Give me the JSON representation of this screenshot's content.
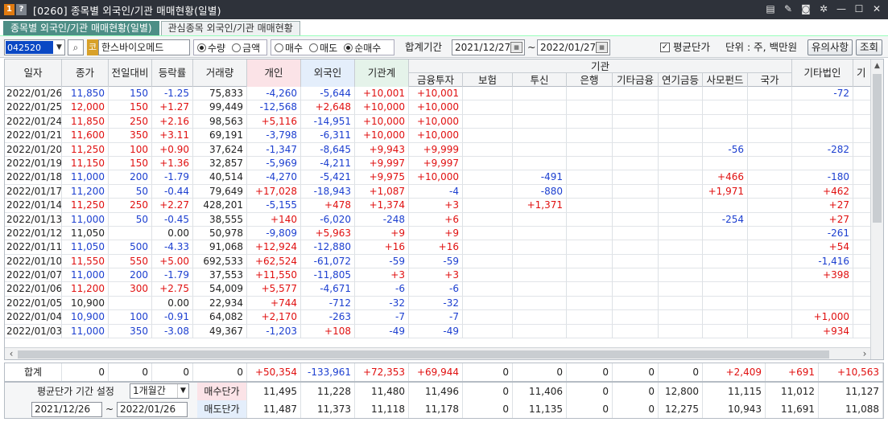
{
  "window": {
    "num_badge": "1",
    "help_badge": "?",
    "title": "[0260] 종목별 외국인/기관 매매현황(일별)",
    "icons": [
      "layout-icon",
      "memo-icon",
      "camera-icon",
      "settings-icon",
      "minimize-icon",
      "maximize-icon",
      "close-icon"
    ]
  },
  "tabs": [
    {
      "label": "종목별 외국인/기관 매매현황(일별)",
      "active": true
    },
    {
      "label": "관심종목 외국인/기관 매매현황",
      "active": false
    }
  ],
  "toolbar": {
    "code": "042520",
    "market_badge": "코",
    "stock_name": "한스바이오메드",
    "unit_options": [
      "수량",
      "금액"
    ],
    "unit_selected": "수량",
    "trade_options": [
      "매수",
      "매도",
      "순매수"
    ],
    "trade_selected": "순매수",
    "period_label": "합계기간",
    "date_from": "2021/12/27",
    "tilde": "~",
    "date_to": "2022/01/27",
    "avg_price_label": "평균단가",
    "avg_price_checked": true,
    "unit_text": "단위 : 주, 백만원",
    "notice_button": "유의사항",
    "query_button": "조회"
  },
  "headers": {
    "date": "일자",
    "close": "종가",
    "change": "전일대비",
    "rate": "등락률",
    "volume": "거래량",
    "individual": "개인",
    "foreign": "외국인",
    "inst_total": "기관계",
    "inst_group": "기관",
    "financial_invest": "금융투자",
    "insurance": "보험",
    "trust": "투신",
    "bank": "은행",
    "other_finance": "기타금융",
    "pension": "연기금등",
    "private_fund": "사모펀드",
    "nation": "국가",
    "other_corp": "기타법인",
    "cut_col": "기"
  },
  "rows": [
    {
      "date": "2022/01/26",
      "close": "11,850",
      "close_c": "blu",
      "change": "150",
      "change_c": "blu",
      "rate": "-1.25",
      "rate_c": "blu",
      "volume": "75,833",
      "ind": "-4,260",
      "frg": "-5,644",
      "inst": "+10,001",
      "fin": "+10,001",
      "ins": "",
      "trs": "",
      "bnk": "",
      "oth": "",
      "pen": "",
      "pef": "",
      "nat": "",
      "corp": "-72"
    },
    {
      "date": "2022/01/25",
      "close": "12,000",
      "close_c": "red",
      "change": "150",
      "change_c": "red",
      "rate": "+1.27",
      "rate_c": "red",
      "volume": "99,449",
      "ind": "-12,568",
      "frg": "+2,648",
      "inst": "+10,000",
      "fin": "+10,000",
      "ins": "",
      "trs": "",
      "bnk": "",
      "oth": "",
      "pen": "",
      "pef": "",
      "nat": "",
      "corp": ""
    },
    {
      "date": "2022/01/24",
      "close": "11,850",
      "close_c": "red",
      "change": "250",
      "change_c": "red",
      "rate": "+2.16",
      "rate_c": "red",
      "volume": "98,563",
      "ind": "+5,116",
      "frg": "-14,951",
      "inst": "+10,000",
      "fin": "+10,000",
      "ins": "",
      "trs": "",
      "bnk": "",
      "oth": "",
      "pen": "",
      "pef": "",
      "nat": "",
      "corp": ""
    },
    {
      "date": "2022/01/21",
      "close": "11,600",
      "close_c": "red",
      "change": "350",
      "change_c": "red",
      "rate": "+3.11",
      "rate_c": "red",
      "volume": "69,191",
      "ind": "-3,798",
      "frg": "-6,311",
      "inst": "+10,000",
      "fin": "+10,000",
      "ins": "",
      "trs": "",
      "bnk": "",
      "oth": "",
      "pen": "",
      "pef": "",
      "nat": "",
      "corp": ""
    },
    {
      "date": "2022/01/20",
      "close": "11,250",
      "close_c": "red",
      "change": "100",
      "change_c": "red",
      "rate": "+0.90",
      "rate_c": "red",
      "volume": "37,624",
      "ind": "-1,347",
      "frg": "-8,645",
      "inst": "+9,943",
      "fin": "+9,999",
      "ins": "",
      "trs": "",
      "bnk": "",
      "oth": "",
      "pen": "",
      "pef": "-56",
      "nat": "",
      "corp": "-282"
    },
    {
      "date": "2022/01/19",
      "close": "11,150",
      "close_c": "red",
      "change": "150",
      "change_c": "red",
      "rate": "+1.36",
      "rate_c": "red",
      "volume": "32,857",
      "ind": "-5,969",
      "frg": "-4,211",
      "inst": "+9,997",
      "fin": "+9,997",
      "ins": "",
      "trs": "",
      "bnk": "",
      "oth": "",
      "pen": "",
      "pef": "",
      "nat": "",
      "corp": ""
    },
    {
      "date": "2022/01/18",
      "close": "11,000",
      "close_c": "blu",
      "change": "200",
      "change_c": "blu",
      "rate": "-1.79",
      "rate_c": "blu",
      "volume": "40,514",
      "ind": "-4,270",
      "frg": "-5,421",
      "inst": "+9,975",
      "fin": "+10,000",
      "ins": "",
      "trs": "-491",
      "bnk": "",
      "oth": "",
      "pen": "",
      "pef": "+466",
      "nat": "",
      "corp": "-180"
    },
    {
      "date": "2022/01/17",
      "close": "11,200",
      "close_c": "blu",
      "change": "50",
      "change_c": "blu",
      "rate": "-0.44",
      "rate_c": "blu",
      "volume": "79,649",
      "ind": "+17,028",
      "frg": "-18,943",
      "inst": "+1,087",
      "fin": "-4",
      "ins": "",
      "trs": "-880",
      "bnk": "",
      "oth": "",
      "pen": "",
      "pef": "+1,971",
      "nat": "",
      "corp": "+462"
    },
    {
      "date": "2022/01/14",
      "close": "11,250",
      "close_c": "red",
      "change": "250",
      "change_c": "red",
      "rate": "+2.27",
      "rate_c": "red",
      "volume": "428,201",
      "ind": "-5,155",
      "frg": "+478",
      "inst": "+1,374",
      "fin": "+3",
      "ins": "",
      "trs": "+1,371",
      "bnk": "",
      "oth": "",
      "pen": "",
      "pef": "",
      "nat": "",
      "corp": "+27"
    },
    {
      "date": "2022/01/13",
      "close": "11,000",
      "close_c": "blu",
      "change": "50",
      "change_c": "blu",
      "rate": "-0.45",
      "rate_c": "blu",
      "volume": "38,555",
      "ind": "+140",
      "frg": "-6,020",
      "inst": "-248",
      "fin": "+6",
      "ins": "",
      "trs": "",
      "bnk": "",
      "oth": "",
      "pen": "",
      "pef": "-254",
      "nat": "",
      "corp": "+27"
    },
    {
      "date": "2022/01/12",
      "close": "11,050",
      "close_c": "blk",
      "change": "",
      "change_c": "blk",
      "rate": "0.00",
      "rate_c": "blk",
      "volume": "50,978",
      "ind": "-9,809",
      "frg": "+5,963",
      "inst": "+9",
      "fin": "+9",
      "ins": "",
      "trs": "",
      "bnk": "",
      "oth": "",
      "pen": "",
      "pef": "",
      "nat": "",
      "corp": "-261"
    },
    {
      "date": "2022/01/11",
      "close": "11,050",
      "close_c": "blu",
      "change": "500",
      "change_c": "blu",
      "rate": "-4.33",
      "rate_c": "blu",
      "volume": "91,068",
      "ind": "+12,924",
      "frg": "-12,880",
      "inst": "+16",
      "fin": "+16",
      "ins": "",
      "trs": "",
      "bnk": "",
      "oth": "",
      "pen": "",
      "pef": "",
      "nat": "",
      "corp": "+54"
    },
    {
      "date": "2022/01/10",
      "close": "11,550",
      "close_c": "red",
      "change": "550",
      "change_c": "red",
      "rate": "+5.00",
      "rate_c": "red",
      "volume": "692,533",
      "ind": "+62,524",
      "frg": "-61,072",
      "inst": "-59",
      "fin": "-59",
      "ins": "",
      "trs": "",
      "bnk": "",
      "oth": "",
      "pen": "",
      "pef": "",
      "nat": "",
      "corp": "-1,416"
    },
    {
      "date": "2022/01/07",
      "close": "11,000",
      "close_c": "blu",
      "change": "200",
      "change_c": "blu",
      "rate": "-1.79",
      "rate_c": "blu",
      "volume": "37,553",
      "ind": "+11,550",
      "frg": "-11,805",
      "inst": "+3",
      "fin": "+3",
      "ins": "",
      "trs": "",
      "bnk": "",
      "oth": "",
      "pen": "",
      "pef": "",
      "nat": "",
      "corp": "+398"
    },
    {
      "date": "2022/01/06",
      "close": "11,200",
      "close_c": "red",
      "change": "300",
      "change_c": "red",
      "rate": "+2.75",
      "rate_c": "red",
      "volume": "54,009",
      "ind": "+5,577",
      "frg": "-4,671",
      "inst": "-6",
      "fin": "-6",
      "ins": "",
      "trs": "",
      "bnk": "",
      "oth": "",
      "pen": "",
      "pef": "",
      "nat": "",
      "corp": ""
    },
    {
      "date": "2022/01/05",
      "close": "10,900",
      "close_c": "blk",
      "change": "",
      "change_c": "blk",
      "rate": "0.00",
      "rate_c": "blk",
      "volume": "22,934",
      "ind": "+744",
      "frg": "-712",
      "inst": "-32",
      "fin": "-32",
      "ins": "",
      "trs": "",
      "bnk": "",
      "oth": "",
      "pen": "",
      "pef": "",
      "nat": "",
      "corp": ""
    },
    {
      "date": "2022/01/04",
      "close": "10,900",
      "close_c": "blu",
      "change": "100",
      "change_c": "blu",
      "rate": "-0.91",
      "rate_c": "blu",
      "volume": "64,082",
      "ind": "+2,170",
      "frg": "-263",
      "inst": "-7",
      "fin": "-7",
      "ins": "",
      "trs": "",
      "bnk": "",
      "oth": "",
      "pen": "",
      "pef": "",
      "nat": "",
      "corp": "+1,000"
    },
    {
      "date": "2022/01/03",
      "close": "11,000",
      "close_c": "blu",
      "change": "350",
      "change_c": "blu",
      "rate": "-3.08",
      "rate_c": "blu",
      "volume": "49,367",
      "ind": "-1,203",
      "frg": "+108",
      "inst": "-49",
      "fin": "-49",
      "ins": "",
      "trs": "",
      "bnk": "",
      "oth": "",
      "pen": "",
      "pef": "",
      "nat": "",
      "corp": "+934"
    }
  ],
  "summary": {
    "label": "합계",
    "close": "0",
    "change": "0",
    "rate": "0",
    "volume": "0",
    "ind": "+50,354",
    "frg": "-133,961",
    "inst": "+72,353",
    "fin": "+69,944",
    "ins": "0",
    "trs": "0",
    "bnk": "0",
    "oth": "0",
    "pen": "0",
    "pef": "+2,409",
    "nat": "+691",
    "corp": "+10,563"
  },
  "avg": {
    "period_label": "평균단가 기간 설정",
    "period_value": "1개월간",
    "date_from": "2021/12/26",
    "tilde": "~",
    "date_to": "2022/01/26",
    "buy_label": "매수단가",
    "sell_label": "매도단가",
    "buy": [
      "11,495",
      "11,228",
      "11,480",
      "11,496",
      "0",
      "11,406",
      "0",
      "0",
      "12,800",
      "11,115",
      "11,012",
      "11,127"
    ],
    "sell": [
      "11,487",
      "11,373",
      "11,118",
      "11,178",
      "0",
      "11,135",
      "0",
      "0",
      "12,275",
      "10,943",
      "11,691",
      "11,088"
    ]
  }
}
